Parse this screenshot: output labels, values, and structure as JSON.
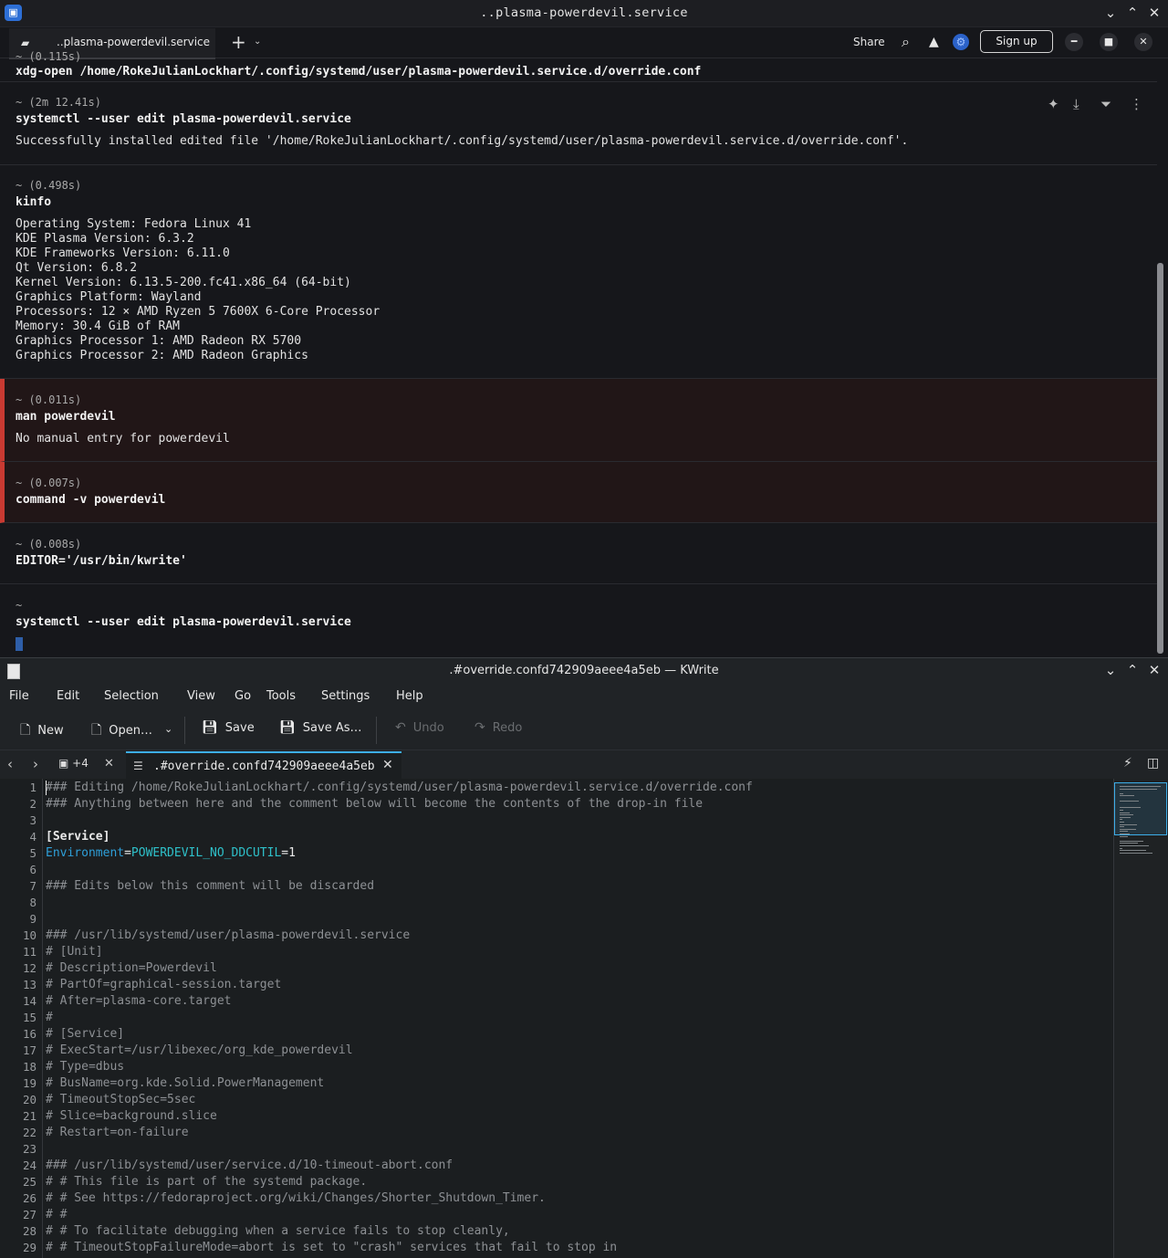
{
  "warp": {
    "window_title": "..plasma-powerdevil.service",
    "tab_label": "..plasma-powerdevil.service",
    "share_label": "Share",
    "signup_label": "Sign up",
    "partial_dir": "~ (0.115s)",
    "partial_cmd": "xdg-open /home/RokeJulianLockhart/.config/systemd/user/plasma-powerdevil.service.d/override.conf",
    "blocks": [
      {
        "dir": "~ (2m 12.41s)",
        "cmd": "systemctl --user edit plasma-powerdevil.service",
        "output": "Successfully installed edited file '/home/RokeJulianLockhart/.config/systemd/user/plasma-powerdevil.service.d/override.conf'."
      },
      {
        "dir": "~ (0.498s)",
        "cmd": "kinfo",
        "output": "Operating System: Fedora Linux 41\nKDE Plasma Version: 6.3.2\nKDE Frameworks Version: 6.11.0\nQt Version: 6.8.2\nKernel Version: 6.13.5-200.fc41.x86_64 (64-bit)\nGraphics Platform: Wayland\nProcessors: 12 × AMD Ryzen 5 7600X 6-Core Processor\nMemory: 30.4 GiB of RAM\nGraphics Processor 1: AMD Radeon RX 5700\nGraphics Processor 2: AMD Radeon Graphics"
      },
      {
        "dir": "~ (0.011s)",
        "cmd": "man powerdevil",
        "output": "No manual entry for powerdevil",
        "error": true
      },
      {
        "dir": "~ (0.007s)",
        "cmd": "command -v powerdevil",
        "output": "",
        "error": true
      },
      {
        "dir": "~ (0.008s)",
        "cmd": "EDITOR='/usr/bin/kwrite'",
        "output": ""
      },
      {
        "dir": "~",
        "cmd": "systemctl --user edit plasma-powerdevil.service",
        "output": ""
      }
    ]
  },
  "kwrite": {
    "window_title": ".#override.confd742909aeee4a5eb — KWrite",
    "menu": [
      "File",
      "Edit",
      "Selection",
      "View",
      "Go",
      "Tools",
      "Settings",
      "Help"
    ],
    "toolbar": {
      "new": "New",
      "open": "Open…",
      "save": "Save",
      "save_as": "Save As…",
      "undo": "Undo",
      "redo": "Redo"
    },
    "hidden_tabs": "+4",
    "tab_label": ".#override.confd742909aeee4a5eb",
    "lines": [
      "### Editing /home/RokeJulianLockhart/.config/systemd/user/plasma-powerdevil.service.d/override.conf",
      "### Anything between here and the comment below will become the contents of the drop-in file",
      "",
      "[Service]",
      "Environment=POWERDEVIL_NO_DDCUTIL=1",
      "",
      "### Edits below this comment will be discarded",
      "",
      "",
      "### /usr/lib/systemd/user/plasma-powerdevil.service",
      "# [Unit]",
      "# Description=Powerdevil",
      "# PartOf=graphical-session.target",
      "# After=plasma-core.target",
      "#",
      "# [Service]",
      "# ExecStart=/usr/libexec/org_kde_powerdevil",
      "# Type=dbus",
      "# BusName=org.kde.Solid.PowerManagement",
      "# TimeoutStopSec=5sec",
      "# Slice=background.slice",
      "# Restart=on-failure",
      "",
      "### /usr/lib/systemd/user/service.d/10-timeout-abort.conf",
      "# # This file is part of the systemd package.",
      "# # See https://fedoraproject.org/wiki/Changes/Shorter_Shutdown_Timer.",
      "# #",
      "# # To facilitate debugging when a service fails to stop cleanly,",
      "# # TimeoutStopFailureMode=abort is set to \"crash\" services that fail to stop in"
    ],
    "env_key": "Environment",
    "env_value": "POWERDEVIL_NO_DDCUTIL",
    "env_num": "1"
  },
  "colors": {
    "error_accent": "#c93a32",
    "kde_accent": "#3daee9",
    "key": "#2e9fd8"
  }
}
